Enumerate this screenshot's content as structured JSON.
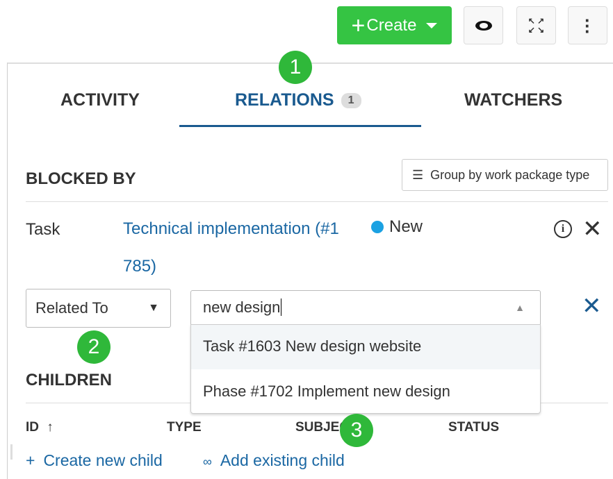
{
  "toolbar": {
    "create_label": "Create",
    "create_icon": "plus-icon",
    "eye_icon": "eye-icon",
    "fullscreen_icon": "expand-icon",
    "more_icon": "more-vertical-icon"
  },
  "tabs": [
    {
      "label": "ACTIVITY"
    },
    {
      "label": "RELATIONS",
      "count": "1",
      "active": true
    },
    {
      "label": "WATCHERS"
    }
  ],
  "blocked_by": {
    "title": "BLOCKED BY",
    "group_button": "Group by work package type",
    "row": {
      "type": "Task",
      "subject_line1": "Technical implementation (#1",
      "subject_line2": "785)",
      "status": "New",
      "status_color": "#1ba1e2"
    }
  },
  "new_relation": {
    "relation_type": "Related To",
    "search_value": "new design",
    "suggestions": [
      "Task #1603 New design website",
      "Phase #1702 Implement new design"
    ]
  },
  "children": {
    "title": "CHILDREN",
    "columns": [
      "ID",
      "TYPE",
      "SUBJECT",
      "STATUS"
    ],
    "create_child": "Create new child",
    "add_existing_child": "Add existing child"
  },
  "callouts": [
    "1",
    "2",
    "3"
  ],
  "colors": {
    "accent": "#1a67a3",
    "create": "#35c443",
    "callout": "#2fb83a"
  }
}
